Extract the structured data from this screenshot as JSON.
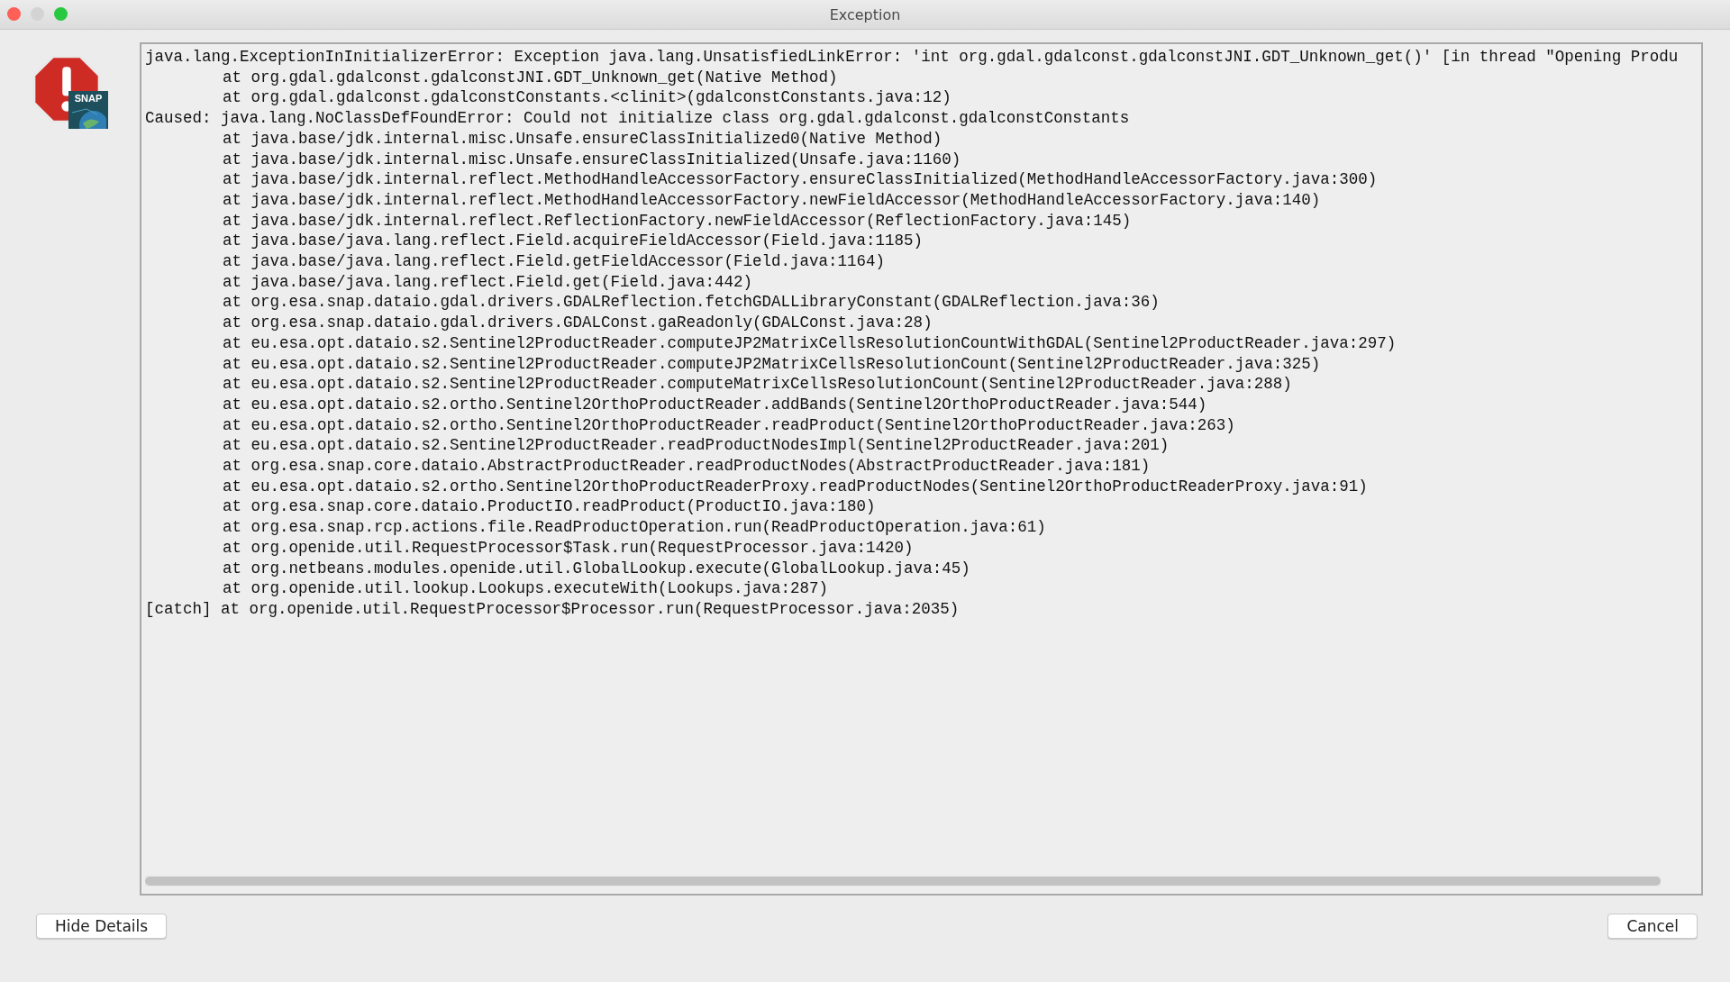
{
  "window": {
    "title": "Exception"
  },
  "trace": [
    {
      "kind": "head",
      "text": "java.lang.ExceptionInInitializerError: Exception java.lang.UnsatisfiedLinkError: 'int org.gdal.gdalconst.gdalconstJNI.GDT_Unknown_get()' [in thread \"Opening Produ"
    },
    {
      "kind": "frame",
      "text": "at org.gdal.gdalconst.gdalconstJNI.GDT_Unknown_get(Native Method)"
    },
    {
      "kind": "frame",
      "text": "at org.gdal.gdalconst.gdalconstConstants.<clinit>(gdalconstConstants.java:12)"
    },
    {
      "kind": "head",
      "text": "Caused: java.lang.NoClassDefFoundError: Could not initialize class org.gdal.gdalconst.gdalconstConstants"
    },
    {
      "kind": "frame",
      "text": "at java.base/jdk.internal.misc.Unsafe.ensureClassInitialized0(Native Method)"
    },
    {
      "kind": "frame",
      "text": "at java.base/jdk.internal.misc.Unsafe.ensureClassInitialized(Unsafe.java:1160)"
    },
    {
      "kind": "frame",
      "text": "at java.base/jdk.internal.reflect.MethodHandleAccessorFactory.ensureClassInitialized(MethodHandleAccessorFactory.java:300)"
    },
    {
      "kind": "frame",
      "text": "at java.base/jdk.internal.reflect.MethodHandleAccessorFactory.newFieldAccessor(MethodHandleAccessorFactory.java:140)"
    },
    {
      "kind": "frame",
      "text": "at java.base/jdk.internal.reflect.ReflectionFactory.newFieldAccessor(ReflectionFactory.java:145)"
    },
    {
      "kind": "frame",
      "text": "at java.base/java.lang.reflect.Field.acquireFieldAccessor(Field.java:1185)"
    },
    {
      "kind": "frame",
      "text": "at java.base/java.lang.reflect.Field.getFieldAccessor(Field.java:1164)"
    },
    {
      "kind": "frame",
      "text": "at java.base/java.lang.reflect.Field.get(Field.java:442)"
    },
    {
      "kind": "frame",
      "text": "at org.esa.snap.dataio.gdal.drivers.GDALReflection.fetchGDALLibraryConstant(GDALReflection.java:36)"
    },
    {
      "kind": "frame",
      "text": "at org.esa.snap.dataio.gdal.drivers.GDALConst.gaReadonly(GDALConst.java:28)"
    },
    {
      "kind": "frame",
      "text": "at eu.esa.opt.dataio.s2.Sentinel2ProductReader.computeJP2MatrixCellsResolutionCountWithGDAL(Sentinel2ProductReader.java:297)"
    },
    {
      "kind": "frame",
      "text": "at eu.esa.opt.dataio.s2.Sentinel2ProductReader.computeJP2MatrixCellsResolutionCount(Sentinel2ProductReader.java:325)"
    },
    {
      "kind": "frame",
      "text": "at eu.esa.opt.dataio.s2.Sentinel2ProductReader.computeMatrixCellsResolutionCount(Sentinel2ProductReader.java:288)"
    },
    {
      "kind": "frame",
      "text": "at eu.esa.opt.dataio.s2.ortho.Sentinel2OrthoProductReader.addBands(Sentinel2OrthoProductReader.java:544)"
    },
    {
      "kind": "frame",
      "text": "at eu.esa.opt.dataio.s2.ortho.Sentinel2OrthoProductReader.readProduct(Sentinel2OrthoProductReader.java:263)"
    },
    {
      "kind": "frame",
      "text": "at eu.esa.opt.dataio.s2.Sentinel2ProductReader.readProductNodesImpl(Sentinel2ProductReader.java:201)"
    },
    {
      "kind": "frame",
      "text": "at org.esa.snap.core.dataio.AbstractProductReader.readProductNodes(AbstractProductReader.java:181)"
    },
    {
      "kind": "frame",
      "text": "at eu.esa.opt.dataio.s2.ortho.Sentinel2OrthoProductReaderProxy.readProductNodes(Sentinel2OrthoProductReaderProxy.java:91)"
    },
    {
      "kind": "frame",
      "text": "at org.esa.snap.core.dataio.ProductIO.readProduct(ProductIO.java:180)"
    },
    {
      "kind": "frame",
      "text": "at org.esa.snap.rcp.actions.file.ReadProductOperation.run(ReadProductOperation.java:61)"
    },
    {
      "kind": "frame",
      "text": "at org.openide.util.RequestProcessor$Task.run(RequestProcessor.java:1420)"
    },
    {
      "kind": "frame",
      "text": "at org.netbeans.modules.openide.util.GlobalLookup.execute(GlobalLookup.java:45)"
    },
    {
      "kind": "frame",
      "text": "at org.openide.util.lookup.Lookups.executeWith(Lookups.java:287)"
    },
    {
      "kind": "head",
      "text": "[catch] at org.openide.util.RequestProcessor$Processor.run(RequestProcessor.java:2035)"
    }
  ],
  "icon_badge": "SNAP",
  "buttons": [
    {
      "kind": "details",
      "label": "Hide Details"
    },
    {
      "kind": "cancel",
      "label": "Cancel"
    }
  ]
}
